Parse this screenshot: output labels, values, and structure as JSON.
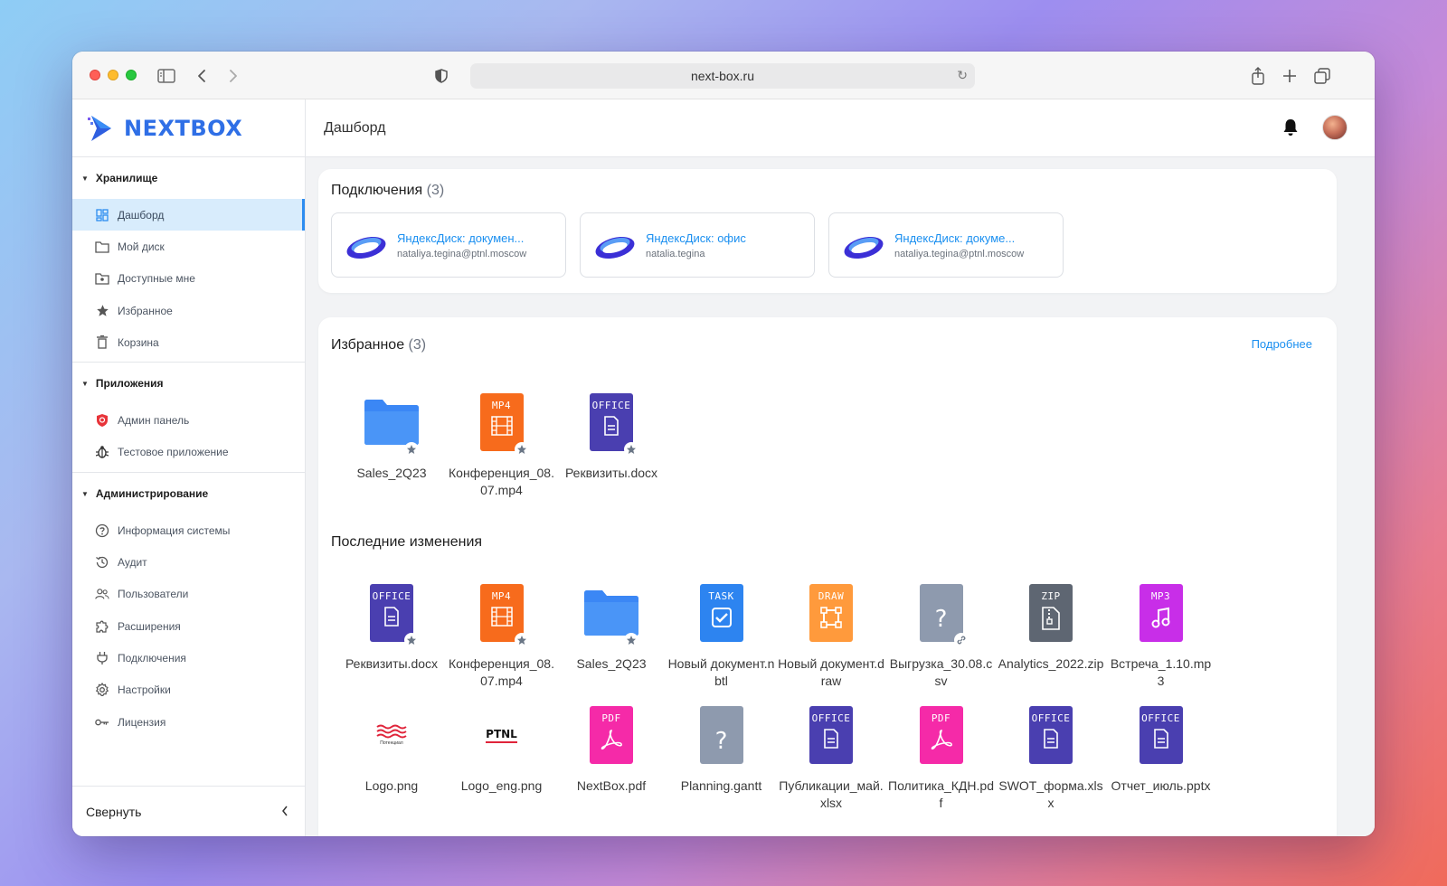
{
  "browser": {
    "url": "next-box.ru"
  },
  "app": {
    "logo_text": "NEXTBOX"
  },
  "sidebar": {
    "sections": [
      {
        "title": "Хранилище",
        "items": [
          {
            "label": "Дашборд",
            "icon": "dashboard-icon",
            "active": true
          },
          {
            "label": "Мой диск",
            "icon": "folder-icon"
          },
          {
            "label": "Доступные мне",
            "icon": "shared-folder-icon"
          },
          {
            "label": "Избранное",
            "icon": "star-icon"
          },
          {
            "label": "Корзина",
            "icon": "trash-icon"
          }
        ]
      },
      {
        "title": "Приложения",
        "items": [
          {
            "label": "Админ панель",
            "icon": "shield-icon"
          },
          {
            "label": "Тестовое приложение",
            "icon": "bug-icon"
          }
        ]
      },
      {
        "title": "Администрирование",
        "items": [
          {
            "label": "Информация системы",
            "icon": "help-circle-icon"
          },
          {
            "label": "Аудит",
            "icon": "history-icon"
          },
          {
            "label": "Пользователи",
            "icon": "users-icon"
          },
          {
            "label": "Расширения",
            "icon": "puzzle-icon"
          },
          {
            "label": "Подключения",
            "icon": "plug-icon"
          },
          {
            "label": "Настройки",
            "icon": "gear-icon"
          },
          {
            "label": "Лицензия",
            "icon": "key-icon"
          }
        ]
      }
    ],
    "collapse_label": "Свернуть"
  },
  "header": {
    "title": "Дашборд"
  },
  "connections": {
    "title": "Подключения",
    "count": "(3)",
    "items": [
      {
        "name": "ЯндексДиск: докумен...",
        "account": "nataliya.tegina@ptnl.moscow"
      },
      {
        "name": "ЯндексДиск: офис",
        "account": "natalia.tegina"
      },
      {
        "name": "ЯндексДиск: докуме...",
        "account": "nataliya.tegina@ptnl.moscow"
      }
    ]
  },
  "favorites": {
    "title": "Избранное",
    "count": "(3)",
    "more_label": "Подробнее",
    "items": [
      {
        "name": "Sales_2Q23",
        "type": "folder"
      },
      {
        "name": "Конференция_08.07.mp4",
        "type": "MP4"
      },
      {
        "name": "Реквизиты.docx",
        "type": "OFFICE"
      }
    ]
  },
  "recent": {
    "title": "Последние изменения",
    "items": [
      {
        "name": "Реквизиты.docx",
        "type": "OFFICE",
        "badge": "star"
      },
      {
        "name": "Конференция_08.07.mp4",
        "type": "MP4",
        "badge": "star"
      },
      {
        "name": "Sales_2Q23",
        "type": "folder",
        "badge": "star"
      },
      {
        "name": "Новый документ.nbtl",
        "type": "TASK"
      },
      {
        "name": "Новый документ.draw",
        "type": "DRAW"
      },
      {
        "name": "Выгрузка_30.08.csv",
        "type": "unknown",
        "badge": "link"
      },
      {
        "name": "Analytics_2022.zip",
        "type": "ZIP"
      },
      {
        "name": "Встреча_1.10.mp3",
        "type": "MP3"
      },
      {
        "name": "Logo.png",
        "type": "image-logo-red",
        "image_text": "Потенциал"
      },
      {
        "name": "Logo_eng.png",
        "type": "image-logo-ptnl",
        "image_text": "PTNL"
      },
      {
        "name": "NextBox.pdf",
        "type": "PDF"
      },
      {
        "name": "Planning.gantt",
        "type": "unknown"
      },
      {
        "name": "Публикации_май.xlsx",
        "type": "OFFICE"
      },
      {
        "name": "Политика_КДН.pdf",
        "type": "PDF"
      },
      {
        "name": "SWOT_форма.xlsx",
        "type": "OFFICE"
      },
      {
        "name": "Отчет_июль.pptx",
        "type": "OFFICE"
      }
    ]
  },
  "colors": {
    "accent": "#1a8ff0",
    "office": "#4a3fb0",
    "mp4": "#f76b1c",
    "folder": "#3b87f5",
    "task": "#2d84f0",
    "draw": "#ff9a3c",
    "unknown": "#8e9aae",
    "zip": "#5e6672",
    "mp3": "#c82ee8",
    "pdf": "#f52aa8"
  }
}
